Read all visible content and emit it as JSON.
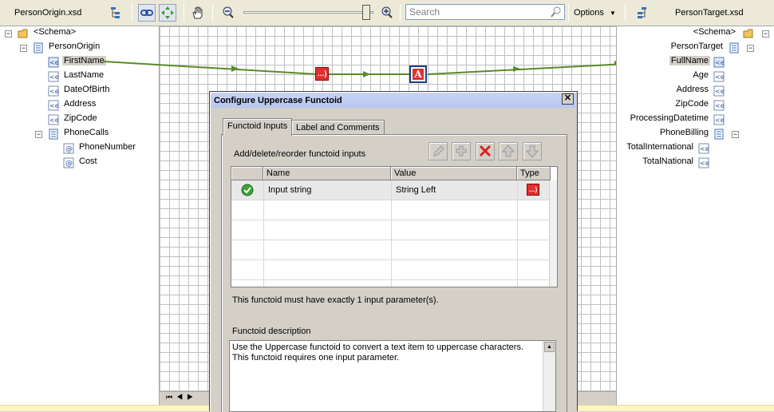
{
  "toolbar": {
    "source_schema": "PersonOrigin.xsd",
    "target_schema": "PersonTarget.xsd",
    "search_placeholder": "Search",
    "options_label": "Options"
  },
  "source_tree": {
    "root": "<Schema>",
    "record": "PersonOrigin",
    "fields": [
      "FirstName",
      "LastName",
      "DateOfBirth",
      "Address",
      "ZipCode"
    ],
    "sub_record": "PhoneCalls",
    "sub_fields": [
      "PhoneNumber",
      "Cost"
    ],
    "selected": "FirstName"
  },
  "target_tree": {
    "root": "<Schema>",
    "record": "PersonTarget",
    "fields": [
      "FullName",
      "Age",
      "Address",
      "ZipCode",
      "ProcessingDatetime"
    ],
    "sub_record": "PhoneBilling",
    "sub_fields": [
      "TotalInternational",
      "TotalNational"
    ],
    "selected": "FullName"
  },
  "functoids": [
    {
      "name": "string-concatenate",
      "glyph": "…)",
      "color": "#e03030"
    },
    {
      "name": "uppercase",
      "glyph": "A",
      "color": "#e03030"
    }
  ],
  "dialog": {
    "title": "Configure Uppercase Functoid",
    "close_label": "✕",
    "tabs": [
      "Functoid Inputs",
      "Label and Comments"
    ],
    "active_tab": "Functoid Inputs",
    "inputs_heading": "Add/delete/reorder functoid inputs",
    "columns": [
      "Name",
      "Value",
      "Type"
    ],
    "rows": [
      {
        "name": "Input string",
        "value": "String Left",
        "type_icon": "link-functoid-icon"
      }
    ],
    "constraint_note": "This functoid must have exactly 1 input parameter(s).",
    "description_heading": "Functoid description",
    "description": "Use the Uppercase functoid to convert a text item to uppercase characters. This functoid requires one input parameter."
  },
  "colors": {
    "link": "#5a8a2a",
    "functoid_red": "#e03030",
    "toolbar_bg": "#ece9d8",
    "status_bar": "#fdf4c1"
  }
}
